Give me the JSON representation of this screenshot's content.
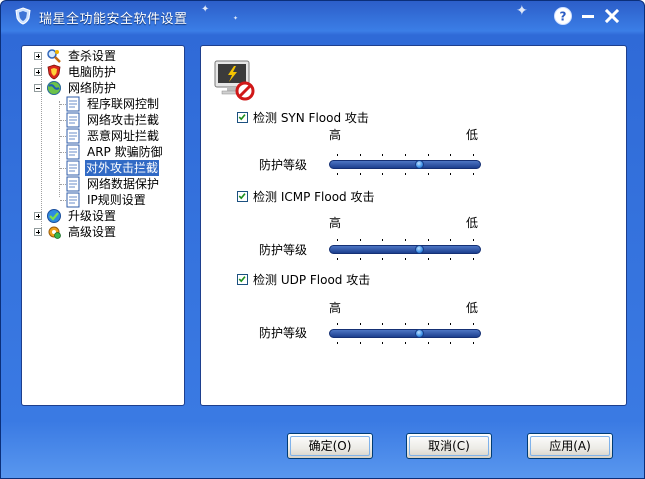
{
  "window": {
    "title": "瑞星全功能安全软件设置",
    "help_glyph": "?",
    "min_glyph": "—",
    "close_glyph": "✕"
  },
  "tree": {
    "items": [
      {
        "label": "查杀设置",
        "icon": "scan-settings-icon",
        "expander": "plus"
      },
      {
        "label": "电脑防护",
        "icon": "pc-protection-icon",
        "expander": "plus"
      },
      {
        "label": "网络防护",
        "icon": "network-protection-icon",
        "expander": "minus"
      },
      {
        "label": "程序联网控制",
        "icon": "page-icon"
      },
      {
        "label": "网络攻击拦截",
        "icon": "page-icon"
      },
      {
        "label": "恶意网址拦截",
        "icon": "page-icon"
      },
      {
        "label": "ARP 欺骗防御",
        "icon": "page-icon"
      },
      {
        "label": "对外攻击拦截",
        "icon": "page-icon",
        "selected": true
      },
      {
        "label": "网络数据保护",
        "icon": "page-icon"
      },
      {
        "label": "IP规则设置",
        "icon": "page-icon"
      },
      {
        "label": "升级设置",
        "icon": "upgrade-icon",
        "expander": "plus"
      },
      {
        "label": "高级设置",
        "icon": "advanced-settings-icon",
        "expander": "plus"
      }
    ]
  },
  "sections": [
    {
      "check_label": "检测 SYN Flood 攻击",
      "checked": true,
      "high": "高",
      "low": "低",
      "level_label": "防护等级",
      "level_fraction": 0.6
    },
    {
      "check_label": "检测 ICMP Flood 攻击",
      "checked": true,
      "high": "高",
      "low": "低",
      "level_label": "防护等级",
      "level_fraction": 0.6
    },
    {
      "check_label": "检测 UDP Flood 攻击",
      "checked": true,
      "high": "高",
      "low": "低",
      "level_label": "防护等级",
      "level_fraction": 0.6
    }
  ],
  "buttons": {
    "ok": "确定(O)",
    "cancel": "取消(C)",
    "apply": "应用(A)"
  },
  "colors": {
    "title_bar": "#2c5ec9",
    "selection": "#316ac5",
    "slider_thumb": "#3b8ee6"
  }
}
